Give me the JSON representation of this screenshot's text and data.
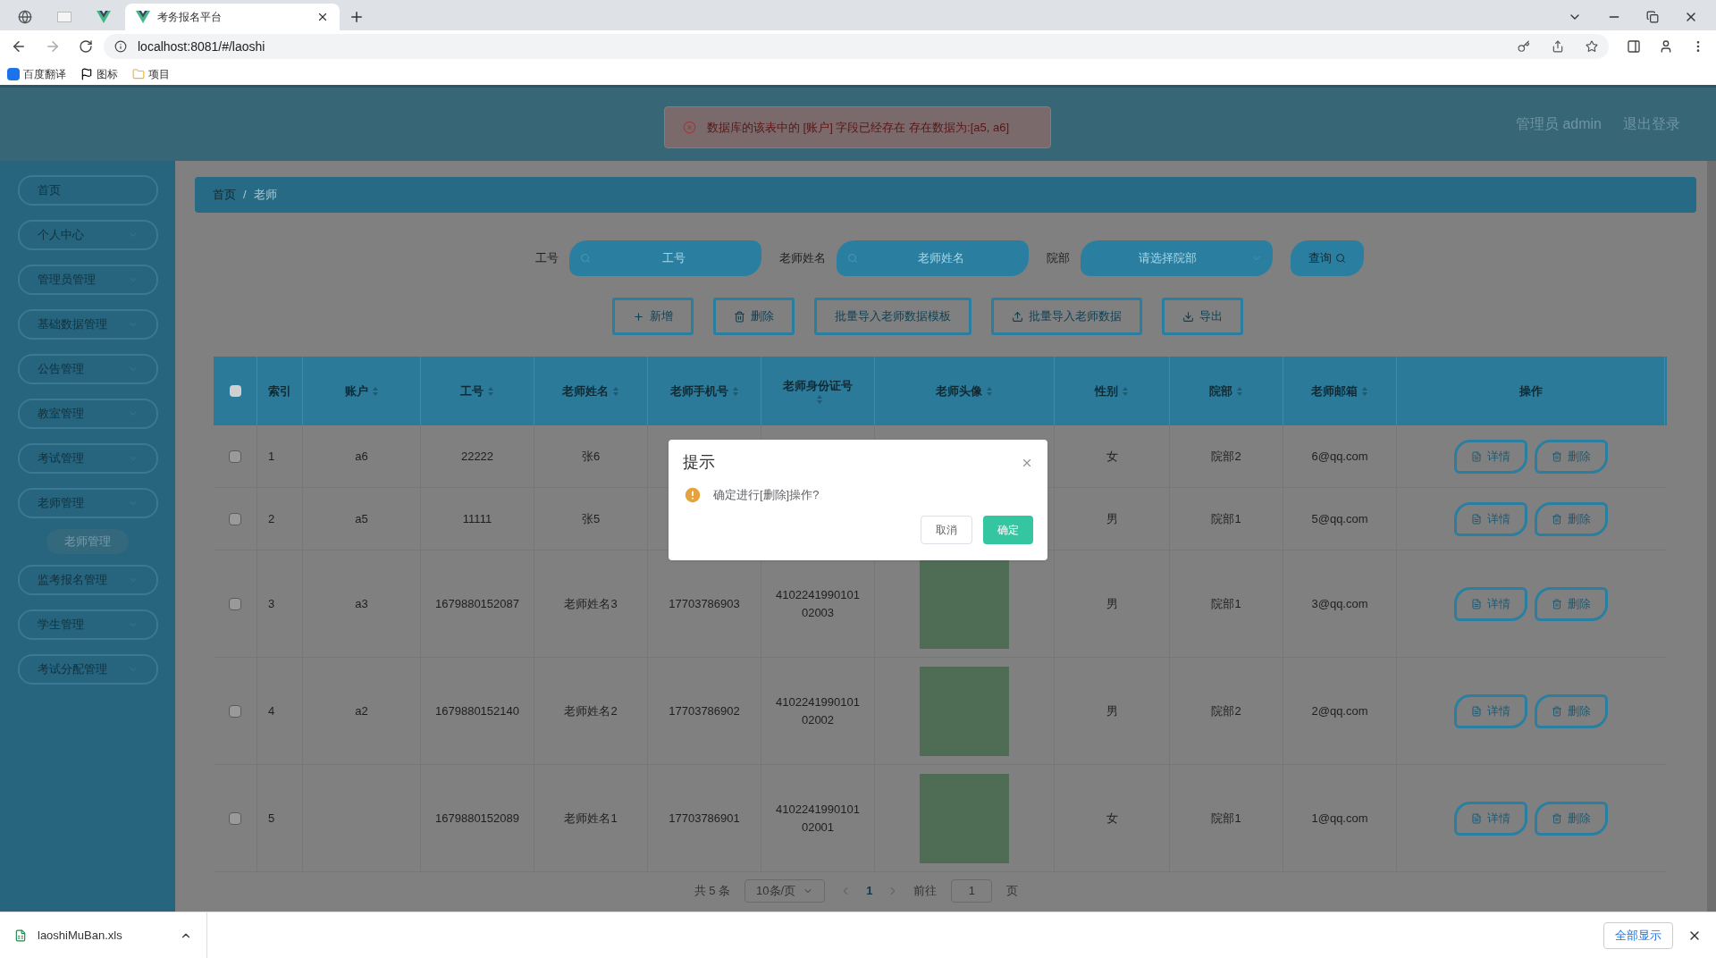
{
  "browser": {
    "tabs": [
      {
        "label": "考务报名平台",
        "selected": true
      }
    ],
    "address": "localhost:8081/#/laoshi",
    "bookmarks": [
      "百度翻译",
      "图标",
      "项目"
    ]
  },
  "header": {
    "toast": "数据库的该表中的 [账户] 字段已经存在 存在数据为:[a5, a6]",
    "user": "管理员 admin",
    "logout": "退出登录"
  },
  "sidebar": {
    "items": [
      {
        "label": "首页"
      },
      {
        "label": "个人中心"
      },
      {
        "label": "管理员管理"
      },
      {
        "label": "基础数据管理"
      },
      {
        "label": "公告管理"
      },
      {
        "label": "教室管理"
      },
      {
        "label": "考试管理"
      },
      {
        "label": "老师管理",
        "children": [
          {
            "label": "老师管理",
            "selected": true
          }
        ]
      },
      {
        "label": "监考报名管理"
      },
      {
        "label": "学生管理"
      },
      {
        "label": "考试分配管理"
      }
    ]
  },
  "breadcrumb": {
    "separator": "/",
    "items": [
      "首页",
      "老师"
    ]
  },
  "search": {
    "fields": [
      {
        "label": "工号",
        "placeholder": "工号",
        "kind": "input"
      },
      {
        "label": "老师姓名",
        "placeholder": "老师姓名",
        "kind": "input"
      },
      {
        "label": "院部",
        "placeholder": "请选择院部",
        "kind": "select"
      }
    ],
    "button": "查询"
  },
  "toolbar": [
    "新增",
    "删除",
    "批量导入老师数据模板",
    "批量导入老师数据",
    "导出"
  ],
  "table": {
    "columns": [
      {
        "label": "索引",
        "sortable": false
      },
      {
        "label": "账户",
        "sortable": true
      },
      {
        "label": "工号",
        "sortable": true
      },
      {
        "label": "老师姓名",
        "sortable": true
      },
      {
        "label": "老师手机号",
        "sortable": true
      },
      {
        "label": "老师身份证号",
        "sortable": true
      },
      {
        "label": "老师头像",
        "sortable": true
      },
      {
        "label": "性别",
        "sortable": true
      },
      {
        "label": "院部",
        "sortable": true
      },
      {
        "label": "老师邮箱",
        "sortable": true
      },
      {
        "label": "操作",
        "sortable": false
      }
    ],
    "all_checked": false,
    "rows": [
      {
        "checked": false,
        "cells": [
          "1",
          "a6",
          "22222",
          "张6",
          "",
          "",
          "",
          "女",
          "院部2",
          "6@qq.com"
        ],
        "actions": [
          "详情",
          "删除"
        ]
      },
      {
        "checked": false,
        "cells": [
          "2",
          "a5",
          "11111",
          "张5",
          "",
          "",
          "",
          "男",
          "院部1",
          "5@qq.com"
        ],
        "actions": [
          "详情",
          "删除"
        ]
      },
      {
        "checked": false,
        "photo": true,
        "cells": [
          "3",
          "a3",
          "1679880152087",
          "老师姓名3",
          "17703786903",
          "410224199010102003",
          "",
          "男",
          "院部1",
          "3@qq.com"
        ],
        "actions": [
          "详情",
          "删除"
        ]
      },
      {
        "checked": false,
        "photo": true,
        "cells": [
          "4",
          "a2",
          "1679880152140",
          "老师姓名2",
          "17703786902",
          "410224199010102002",
          "",
          "男",
          "院部2",
          "2@qq.com"
        ],
        "actions": [
          "详情",
          "删除"
        ]
      },
      {
        "checked": false,
        "photo": true,
        "cells": [
          "5",
          "",
          "1679880152089",
          "老师姓名1",
          "17703786901",
          "410224199010102001",
          "",
          "女",
          "院部1",
          "1@qq.com"
        ],
        "actions": [
          "详情",
          "删除"
        ]
      }
    ]
  },
  "pagination": {
    "total": "共 5 条",
    "page_size": "10条/页",
    "pages": [
      {
        "label": "1",
        "selected": true
      }
    ],
    "goto": "前往",
    "goto_value": "1",
    "goto_suffix": "页"
  },
  "dialog": {
    "title": "提示",
    "message": "确定进行[删除]操作?",
    "cancel": "取消",
    "confirm": "确定"
  },
  "downloads": {
    "file": "laoshiMuBan.xls",
    "show_all": "全部显示"
  }
}
